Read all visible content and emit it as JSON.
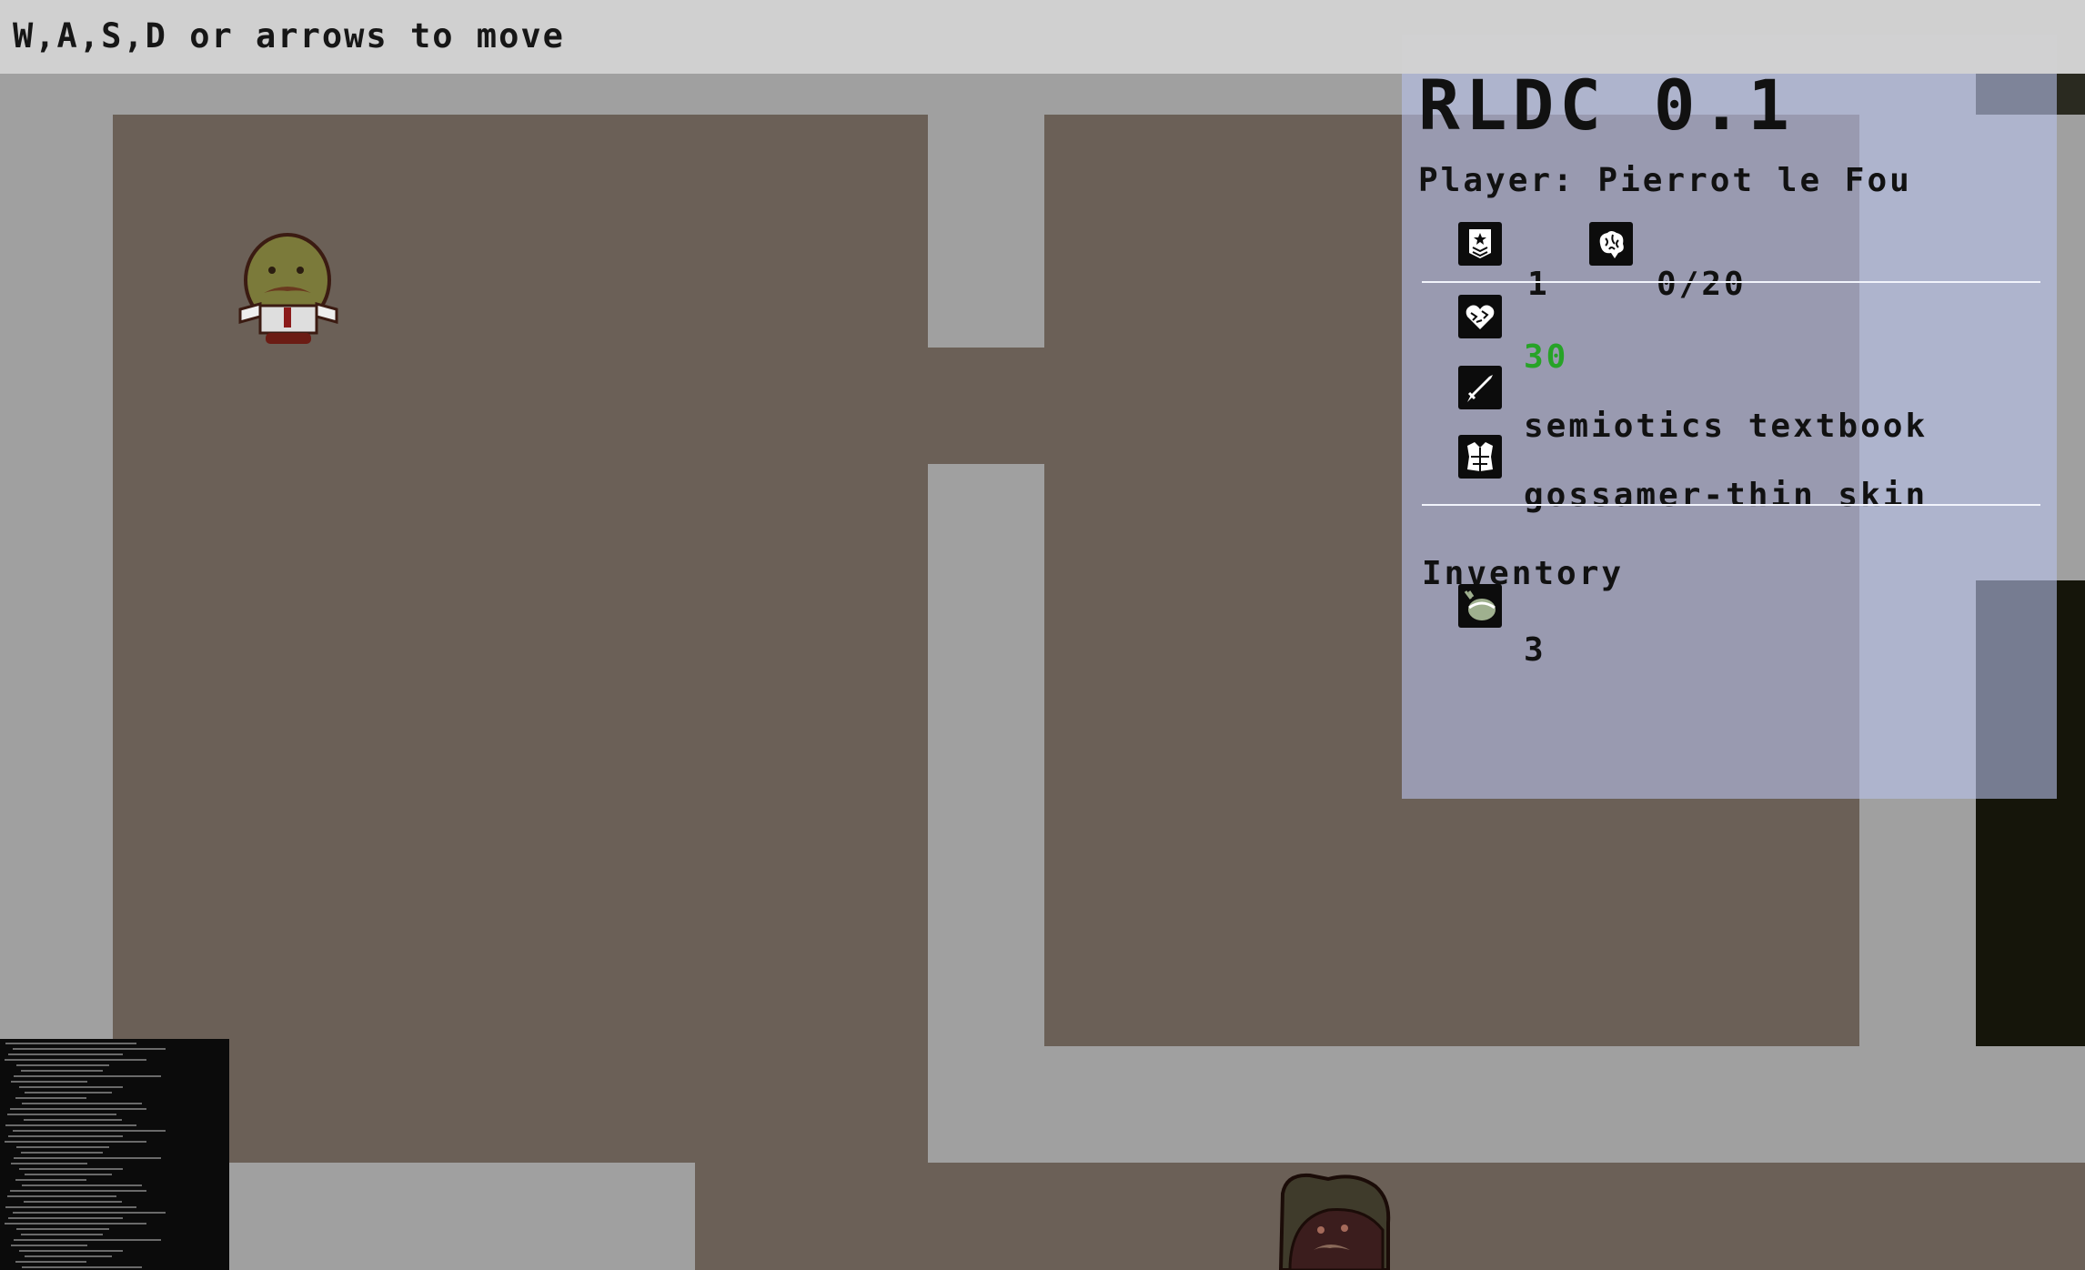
{
  "hint_text": "W,A,S,D or arrows to move",
  "hud": {
    "title": "RLDC 0.1",
    "player_label": "Player: Pierrot le Fou",
    "level": "1",
    "xp": "0/20",
    "hp": "30",
    "weapon": "semiotics textbook",
    "armor": "gossamer-thin skin",
    "inventory_header": "Inventory",
    "inventory_items": [
      {
        "icon": "potion-icon",
        "count": "3"
      }
    ]
  },
  "colors": {
    "floor": "#6b6057",
    "corridor": "#a0a0a0",
    "panel": "#b7c1eb",
    "hp": "#27a327",
    "topbar": "#d2d2d2"
  },
  "icons": [
    "rank-badge-icon",
    "brain-icon",
    "heart-icon",
    "sword-icon",
    "armor-icon",
    "potion-icon"
  ]
}
